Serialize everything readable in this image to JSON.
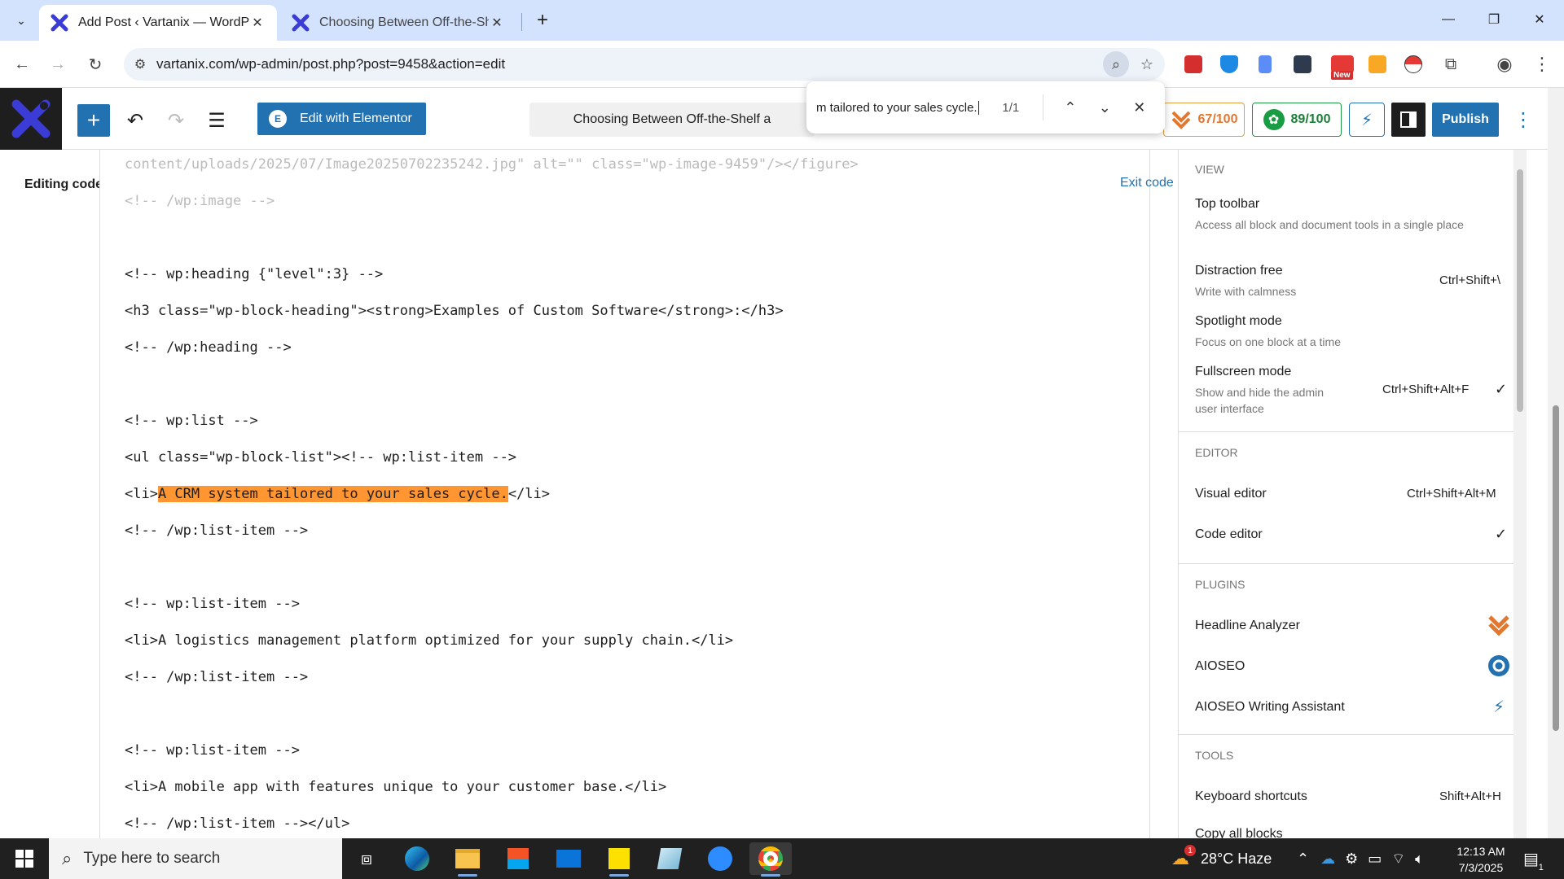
{
  "browser": {
    "tabs": [
      {
        "title": "Add Post ‹ Vartanix — WordPress",
        "active": true
      },
      {
        "title": "Choosing Between Off-the-Shelf",
        "active": false
      }
    ],
    "url": "vartanix.com/wp-admin/post.php?post=9458&action=edit",
    "ext_badge": "New"
  },
  "find": {
    "query": "m tailored to your sales cycle.",
    "count": "1/1"
  },
  "wp_header": {
    "elementor_label": "Edit with Elementor",
    "doc_title": "Choosing Between Off-the-Shelf a",
    "headline_score": "67/100",
    "aioseo_score": "89/100",
    "publish_label": "Publish"
  },
  "editor": {
    "editing_label": "Editing code",
    "exit_label": "Exit code",
    "lines": [
      {
        "text": "content/uploads/2025/07/Image20250702235242.jpg\" alt=\"\" class=\"wp-image-9459\"/></figure>",
        "faded": true
      },
      {
        "text": "<!-- /wp:image -->",
        "faded": true
      },
      {
        "text": "<!-- wp:heading {\"level\":3} -->"
      },
      {
        "text": "<h3 class=\"wp-block-heading\"><strong>Examples of Custom Software</strong>:</h3>"
      },
      {
        "text": "<!-- /wp:heading -->"
      },
      {
        "text": "<!-- wp:list -->"
      },
      {
        "text": "<ul class=\"wp-block-list\"><!-- wp:list-item -->"
      },
      {
        "pre": "<li>",
        "highlight": "A CRM system tailored to your sales cycle.",
        "post": "</li>"
      },
      {
        "text": "<!-- /wp:list-item -->"
      },
      {
        "text": "<!-- wp:list-item -->"
      },
      {
        "text": "<li>A logistics management platform optimized for your supply chain.</li>"
      },
      {
        "text": "<!-- /wp:list-item -->"
      },
      {
        "text": "<!-- wp:list-item -->"
      },
      {
        "text": "<li>A mobile app with features unique to your customer base.</li>"
      },
      {
        "text": "<!-- /wp:list-item --></ul>"
      }
    ]
  },
  "options_menu": {
    "view_title": "View",
    "view_items": [
      {
        "label": "Top toolbar",
        "desc": "Access all block and document tools in a single place",
        "shortcut": "",
        "checked": false
      },
      {
        "label": "Distraction free",
        "desc": "Write with calmness",
        "shortcut": "Ctrl+Shift+\\",
        "checked": false
      },
      {
        "label": "Spotlight mode",
        "desc": "Focus on one block at a time",
        "shortcut": "",
        "checked": false
      },
      {
        "label": "Fullscreen mode",
        "desc": "Show and hide the admin user interface",
        "shortcut": "Ctrl+Shift+Alt+F",
        "checked": true
      }
    ],
    "editor_title": "Editor",
    "editor_items": [
      {
        "label": "Visual editor",
        "shortcut": "Ctrl+Shift+Alt+M",
        "checked": false
      },
      {
        "label": "Code editor",
        "shortcut": "",
        "checked": true
      }
    ],
    "plugins_title": "Plugins",
    "plugin_items": [
      {
        "label": "Headline Analyzer",
        "icon": "headline-analyzer-icon"
      },
      {
        "label": "AIOSEO",
        "icon": "aioseo-icon"
      },
      {
        "label": "AIOSEO Writing Assistant",
        "icon": "writing-assistant-icon"
      }
    ],
    "tools_title": "Tools",
    "tool_items": [
      {
        "label": "Keyboard shortcuts",
        "shortcut": "Shift+Alt+H"
      },
      {
        "label": "Copy all blocks",
        "shortcut": ""
      }
    ]
  },
  "taskbar": {
    "search_placeholder": "Type here to search",
    "weather": "28°C Haze",
    "weather_badge": "1",
    "time": "12:13 AM",
    "date": "7/3/2025",
    "notif_count": "1"
  },
  "colors": {
    "wp_blue": "#2271b1",
    "highlight": "#ff9632",
    "headline_orange": "#e27730",
    "aioseo_green": "#1a7f37",
    "chrome_tab_bg": "#d3e3fd"
  }
}
